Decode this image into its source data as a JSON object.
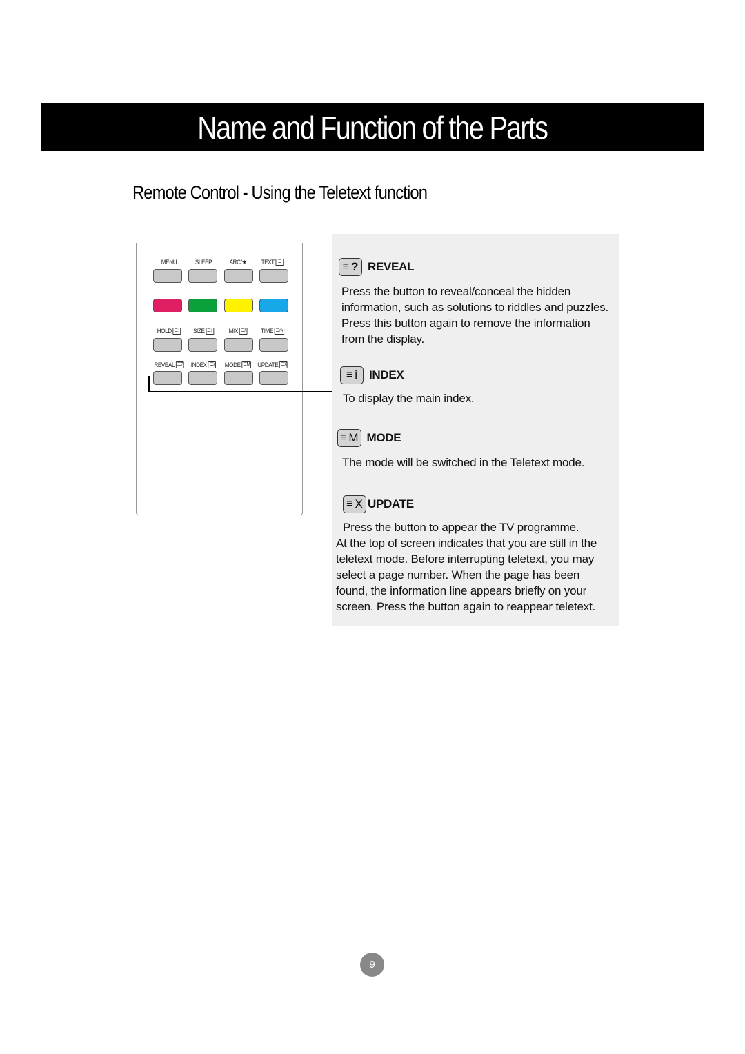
{
  "header": {
    "title": "Name and Function of the Parts",
    "subtitle": "Remote Control - Using the Teletext function"
  },
  "remote": {
    "rows": [
      {
        "type": "labels",
        "items": [
          {
            "label": "MENU",
            "icon": ""
          },
          {
            "label": "SLEEP",
            "icon": ""
          },
          {
            "label": "ARC/★",
            "icon": ""
          },
          {
            "label": "TEXT",
            "icon": "☰"
          }
        ]
      },
      {
        "type": "keys",
        "colors": [
          "gray",
          "gray",
          "gray",
          "gray"
        ]
      },
      {
        "type": "keys",
        "colors": [
          "red",
          "green",
          "yellow",
          "blue"
        ]
      },
      {
        "type": "labels",
        "items": [
          {
            "label": "HOLD",
            "icon": "☰↕"
          },
          {
            "label": "SIZE",
            "icon": "☰↕"
          },
          {
            "label": "MIX",
            "icon": "☰/"
          },
          {
            "label": "TIME",
            "icon": "☰◷"
          }
        ]
      },
      {
        "type": "keys",
        "colors": [
          "gray",
          "gray",
          "gray",
          "gray"
        ]
      },
      {
        "type": "labels",
        "items": [
          {
            "label": "REVEAL",
            "icon": "☰?"
          },
          {
            "label": "INDEX",
            "icon": "☰i"
          },
          {
            "label": "MODE",
            "icon": "☰M"
          },
          {
            "label": "UPDATE",
            "icon": "☰X"
          }
        ]
      },
      {
        "type": "keys",
        "colors": [
          "gray",
          "gray",
          "gray",
          "gray"
        ]
      }
    ]
  },
  "sections": [
    {
      "id": "reveal",
      "icon_glyph": "?",
      "title": "REVEAL",
      "body": "Press the button to reveal/conceal the hidden information, such as solutions to riddles and puzzles. Press this button again to remove the information from the display."
    },
    {
      "id": "index",
      "icon_glyph": "i",
      "title": "INDEX",
      "body": "To display the main index."
    },
    {
      "id": "mode",
      "icon_glyph": "M",
      "title": "MODE",
      "body": "The mode will be switched in the Teletext mode."
    },
    {
      "id": "update",
      "icon_glyph": "X",
      "title": "UPDATE",
      "body_first": "Press the button to appear the TV programme.",
      "body": "At the top of screen indicates that you are still in the teletext mode. Before interrupting teletext, you may select a page number. When the page has been found, the information line appears briefly on your screen. Press the button again to reappear teletext."
    }
  ],
  "footer": {
    "page_number": "9"
  }
}
